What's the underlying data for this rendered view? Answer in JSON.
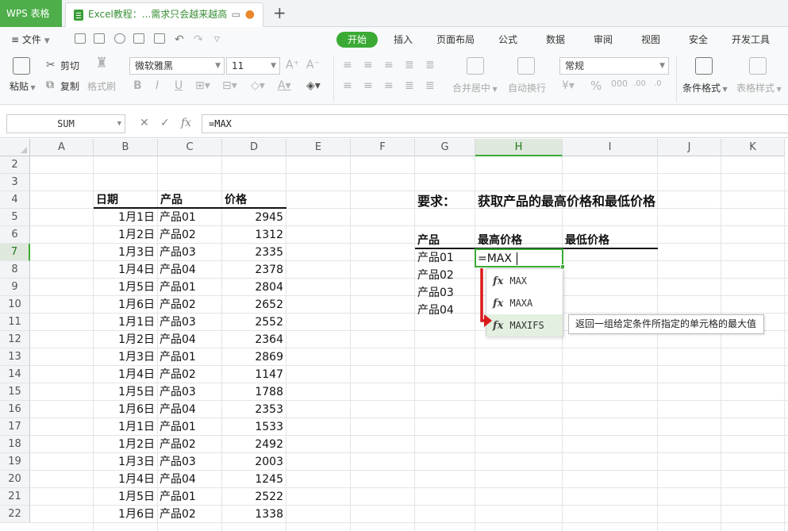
{
  "tabs": {
    "app": "WPS 表格",
    "doc": "Excel教程：...需求只会越来越高",
    "new_tab": "+"
  },
  "menu": {
    "file": "文件",
    "tabs": [
      "开始",
      "插入",
      "页面布局",
      "公式",
      "数据",
      "审阅",
      "视图",
      "安全",
      "开发工具"
    ],
    "active": "开始"
  },
  "ribbon": {
    "paste": "粘贴",
    "cut": "剪切",
    "copy": "复制",
    "format_painter": "格式刷",
    "font_name": "微软雅黑",
    "font_size": "11",
    "merge_center": "合并居中",
    "wrap_text": "自动换行",
    "number_format": "常规",
    "conditional_format": "条件格式",
    "table_style": "表格样式"
  },
  "formula_bar": {
    "name_box": "SUM",
    "formula": "=MAX"
  },
  "columns": [
    "A",
    "B",
    "C",
    "D",
    "E",
    "F",
    "G",
    "H",
    "I",
    "J",
    "K"
  ],
  "rows": [
    "2",
    "3",
    "4",
    "5",
    "6",
    "7",
    "8",
    "9",
    "10",
    "11",
    "12",
    "13",
    "14",
    "15",
    "16",
    "17",
    "18",
    "19",
    "20",
    "21",
    "22"
  ],
  "selected_column": "H",
  "selected_row": "7",
  "table": {
    "headers": [
      "日期",
      "产品",
      "价格"
    ],
    "rows": [
      [
        "1月1日",
        "产品01",
        "2945"
      ],
      [
        "1月2日",
        "产品02",
        "1312"
      ],
      [
        "1月3日",
        "产品03",
        "2335"
      ],
      [
        "1月4日",
        "产品04",
        "2378"
      ],
      [
        "1月5日",
        "产品01",
        "2804"
      ],
      [
        "1月6日",
        "产品02",
        "2652"
      ],
      [
        "1月1日",
        "产品03",
        "2552"
      ],
      [
        "1月2日",
        "产品04",
        "2364"
      ],
      [
        "1月3日",
        "产品01",
        "2869"
      ],
      [
        "1月4日",
        "产品02",
        "1147"
      ],
      [
        "1月5日",
        "产品03",
        "1788"
      ],
      [
        "1月6日",
        "产品04",
        "2353"
      ],
      [
        "1月1日",
        "产品01",
        "1533"
      ],
      [
        "1月2日",
        "产品02",
        "2492"
      ],
      [
        "1月3日",
        "产品03",
        "2003"
      ],
      [
        "1月4日",
        "产品04",
        "1245"
      ],
      [
        "1月5日",
        "产品01",
        "2522"
      ],
      [
        "1月6日",
        "产品02",
        "1338"
      ]
    ]
  },
  "requirement": {
    "label": "要求：",
    "text": "获取产品的最高价格和最低价格"
  },
  "result": {
    "headers": [
      "产品",
      "最高价格",
      "最低价格"
    ],
    "products": [
      "产品01",
      "产品02",
      "产品03",
      "产品04"
    ],
    "editing_value": "=MAX"
  },
  "autocomplete": {
    "items": [
      "MAX",
      "MAXA",
      "MAXIFS"
    ],
    "highlighted": "MAXIFS",
    "tooltip": "返回一组给定条件所指定的单元格的最大值"
  },
  "colors": {
    "accent": "#3aaa35",
    "arrow": "#d9191c"
  }
}
